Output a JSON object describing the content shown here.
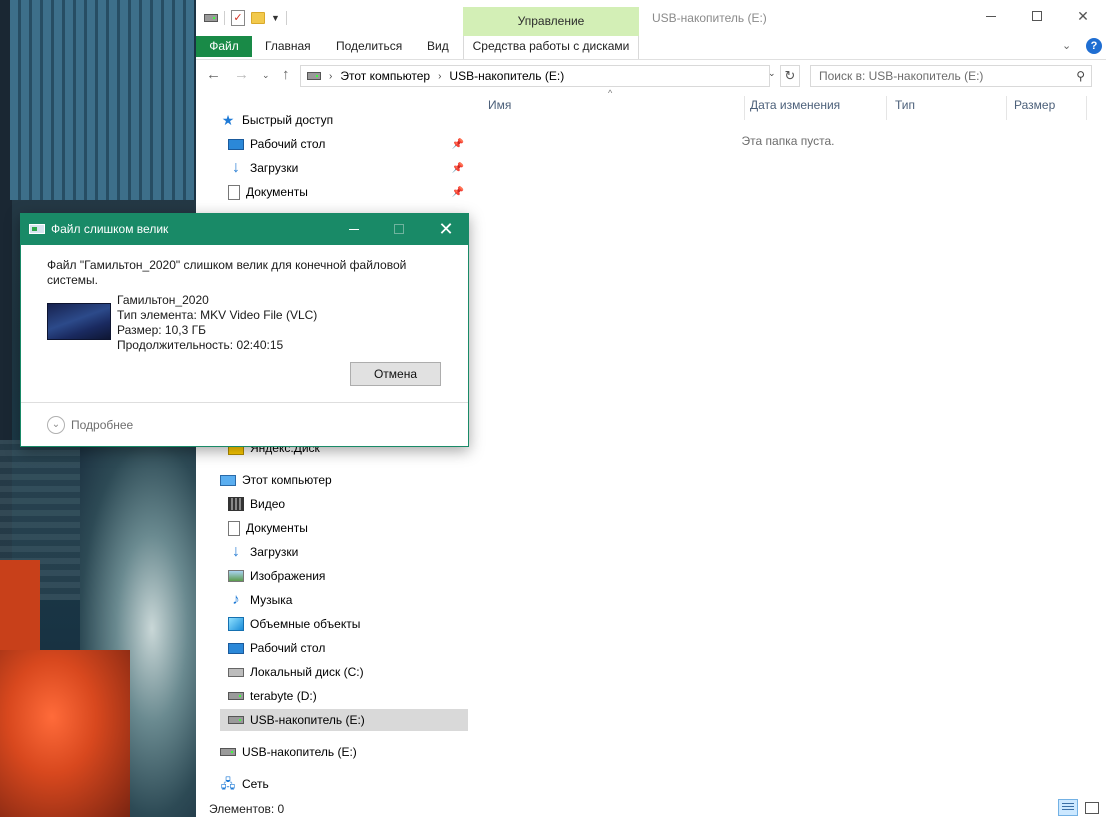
{
  "explorer": {
    "title": "USB-накопитель (E:)",
    "context_tab_group": "Управление",
    "ribbon_tabs": {
      "file": "Файл",
      "home": "Главная",
      "share": "Поделиться",
      "view": "Вид",
      "disk_tools": "Средства работы с дисками"
    },
    "address": {
      "crumb_pc": "Этот компьютер",
      "crumb_drive": "USB-накопитель (E:)"
    },
    "search_placeholder": "Поиск в: USB-накопитель (E:)",
    "columns": {
      "name": "Имя",
      "date": "Дата изменения",
      "type": "Тип",
      "size": "Размер"
    },
    "empty_message": "Эта папка пуста.",
    "status_count": "Элементов: 0",
    "nav": {
      "quick_access": "Быстрый доступ",
      "qa_items": [
        "Рабочий стол",
        "Загрузки",
        "Документы"
      ],
      "yandex": "Яндекс.Диск",
      "this_pc": "Этот компьютер",
      "pc_items": [
        "Видео",
        "Документы",
        "Загрузки",
        "Изображения",
        "Музыка",
        "Объемные объекты",
        "Рабочий стол",
        "Локальный диск (C:)",
        "terabyte (D:)",
        "USB-накопитель (E:)"
      ],
      "usb_root": "USB-накопитель (E:)",
      "network": "Сеть"
    }
  },
  "dialog": {
    "title": "Файл слишком велик",
    "message": "Файл \"Гамильтон_2020\" слишком велик для конечной файловой системы.",
    "file_name": "Гамильтон_2020",
    "file_type": "Тип элемента: MKV Video File (VLC)",
    "file_size": "Размер: 10,3 ГБ",
    "file_duration": "Продолжительность: 02:40:15",
    "cancel_label": "Отмена",
    "more_label": "Подробнее"
  },
  "colors": {
    "ribbon_file_tab": "#198a47",
    "context_tab": "#d3efb6",
    "dialog_titlebar": "#198a67",
    "selection": "#cce8ff"
  }
}
